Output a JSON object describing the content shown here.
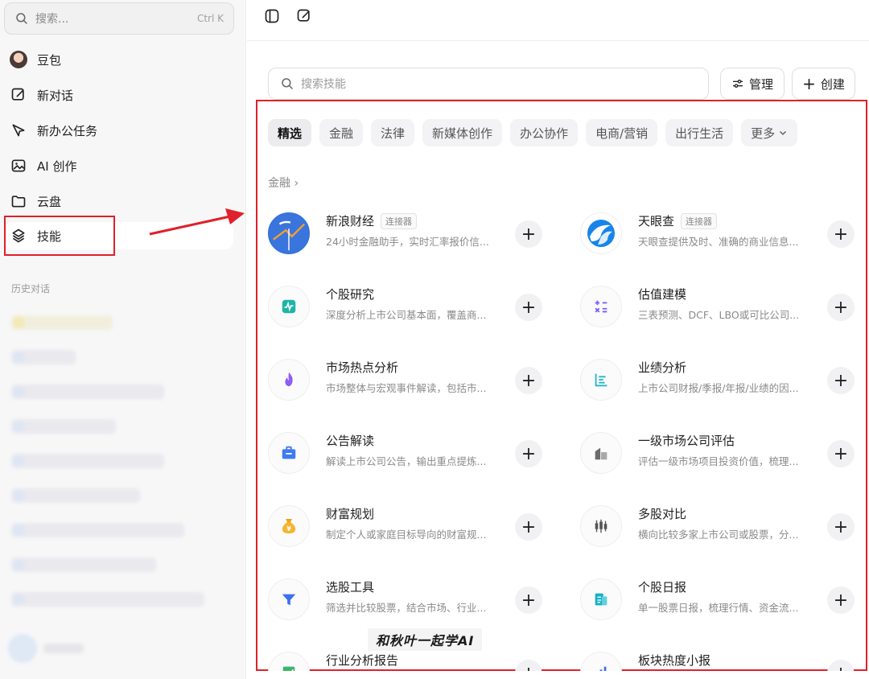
{
  "sidebar": {
    "search": {
      "placeholder": "搜索...",
      "shortcut": "Ctrl K"
    },
    "items": [
      {
        "label": "豆包",
        "icon": "avatar"
      },
      {
        "label": "新对话",
        "icon": "edit-icon"
      },
      {
        "label": "新办公任务",
        "icon": "cursor-icon"
      },
      {
        "label": "AI 创作",
        "icon": "image-icon"
      },
      {
        "label": "云盘",
        "icon": "folder-icon"
      },
      {
        "label": "技能",
        "icon": "layers-icon"
      }
    ],
    "history_title": "历史对话"
  },
  "main": {
    "skill_search_placeholder": "搜索技能",
    "manage_label": "管理",
    "create_label": "创建",
    "chips": [
      "精选",
      "金融",
      "法律",
      "新媒体创作",
      "办公协作",
      "电商/营销",
      "出行生活",
      "更多"
    ],
    "section_title": "金融 ›",
    "cards": [
      {
        "name": "新浪财经",
        "tag": "连接器",
        "desc": "24小时金融助手，实时汇率报价信...",
        "icon": "sina-logo"
      },
      {
        "name": "天眼查",
        "tag": "连接器",
        "desc": "天眼查提供及时、准确的商业信息...",
        "icon": "tianyancha-logo"
      },
      {
        "name": "个股研究",
        "tag": "",
        "desc": "深度分析上市公司基本面，覆盖商...",
        "icon": "pulse-icon"
      },
      {
        "name": "估值建模",
        "tag": "",
        "desc": "三表预测、DCF、LBO或可比公司...",
        "icon": "calculator-icon"
      },
      {
        "name": "市场热点分析",
        "tag": "",
        "desc": "市场整体与宏观事件解读，包括市...",
        "icon": "flame-icon"
      },
      {
        "name": "业绩分析",
        "tag": "",
        "desc": "上市公司财报/季报/年报/业绩的因...",
        "icon": "list-icon"
      },
      {
        "name": "公告解读",
        "tag": "",
        "desc": "解读上市公司公告，输出重点提炼...",
        "icon": "briefcase-icon"
      },
      {
        "name": "一级市场公司评估",
        "tag": "",
        "desc": "评估一级市场项目投资价值，梳理...",
        "icon": "building-icon"
      },
      {
        "name": "财富规划",
        "tag": "",
        "desc": "制定个人或家庭目标导向的财富规...",
        "icon": "money-bag-icon"
      },
      {
        "name": "多股对比",
        "tag": "",
        "desc": "横向比较多家上市公司或股票，分...",
        "icon": "candlestick-icon"
      },
      {
        "name": "选股工具",
        "tag": "",
        "desc": "筛选并比较股票，结合市场、行业...",
        "icon": "filter-icon"
      },
      {
        "name": "个股日报",
        "tag": "",
        "desc": "单一股票日报，梳理行情、资金流...",
        "icon": "report-icon"
      },
      {
        "name": "行业分析报告",
        "tag": "",
        "desc": "",
        "icon": "chart-report-icon"
      },
      {
        "name": "板块热度小报",
        "tag": "",
        "desc": "",
        "icon": "bar-chart-icon"
      }
    ]
  },
  "watermark": "和秋叶一起学AI",
  "colors": {
    "annotation": "#e0202a",
    "accent_blue": "#2f6fe0",
    "accent_purple": "#7c5cff"
  }
}
